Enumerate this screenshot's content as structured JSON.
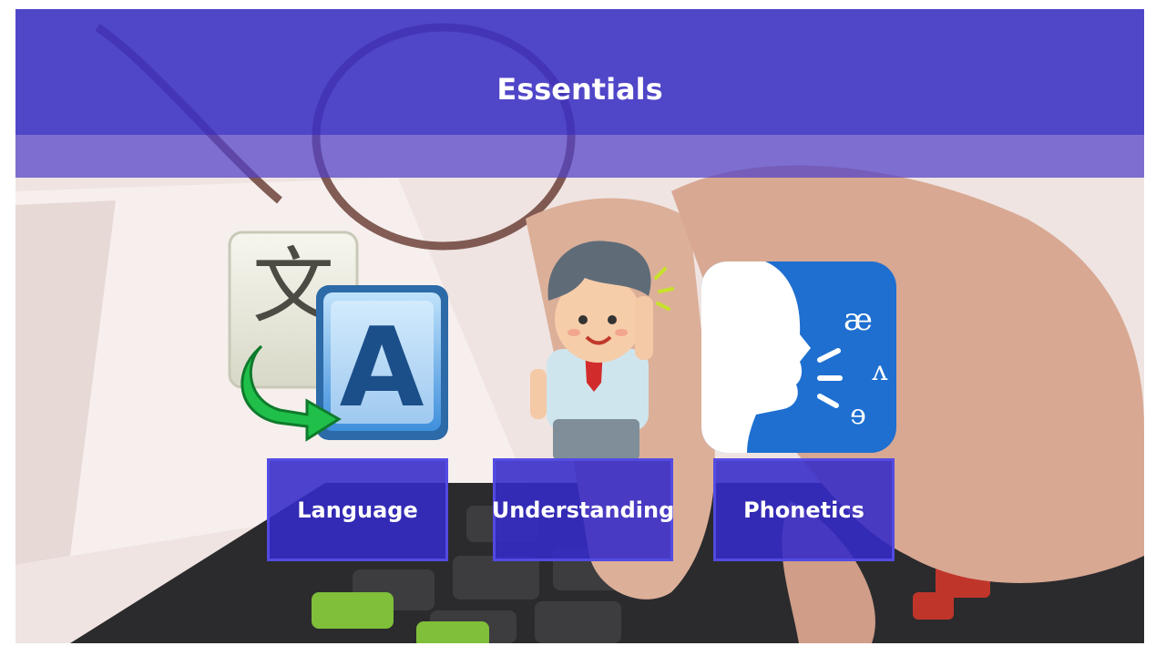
{
  "slide": {
    "title": "Essentials",
    "topics": [
      {
        "label": "Language",
        "icon": "translate-icon"
      },
      {
        "label": "Understanding",
        "icon": "thinking-person-icon"
      },
      {
        "label": "Phonetics",
        "icon": "phonetics-head-icon"
      }
    ],
    "phonetic_symbols": [
      "æ",
      "ʌ",
      "ɘ"
    ],
    "translate_glyphs": [
      "文",
      "A"
    ],
    "colors": {
      "header": "#3a30c4",
      "button": "#342ac8",
      "phonetics_tile": "#1e6fd0",
      "arrow": "#1fbf4a"
    }
  }
}
